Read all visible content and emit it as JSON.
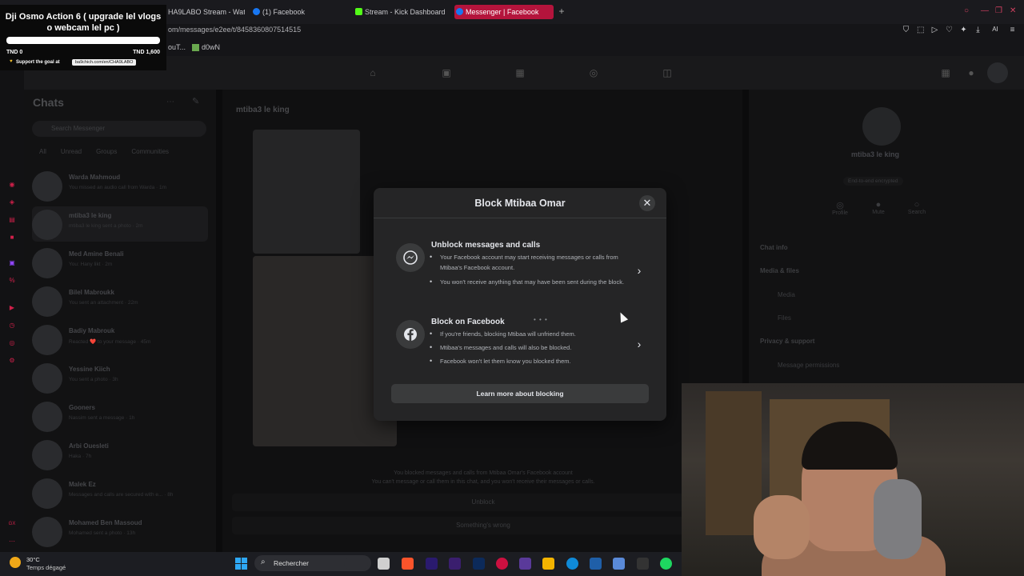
{
  "browser": {
    "tabs": [
      {
        "label": "HA9LABO Stream - Watc",
        "active": false
      },
      {
        "label": "(1) Facebook",
        "active": false
      },
      {
        "label": "Stream - Kick Dashboard",
        "active": false
      },
      {
        "label": "Messenger | Facebook",
        "active": true
      }
    ],
    "new_tab": "+",
    "url": "om/messages/e2ee/t/8458360807514515",
    "bookmarks": [
      "ouT...",
      "d0wN"
    ],
    "toolbar_icons": [
      "bookmark-icon",
      "crop-icon",
      "play-icon",
      "heart-icon",
      "extensions-icon",
      "download-icon",
      "ai-icon",
      "menu-icon"
    ],
    "ai_label": "AI"
  },
  "donation": {
    "title": "Dji Osmo Action 6 ( upgrade lel vlogs o webcam lel pc )",
    "min": "TND 0",
    "max": "TND 1,600",
    "progress": 0,
    "support_text": "Support the goal at",
    "link": "ba9chich.com/en/CHA9LABO"
  },
  "messenger": {
    "chats_title": "Chats",
    "search_placeholder": "Search Messenger",
    "filters": [
      "All",
      "Unread",
      "Groups",
      "Communities"
    ],
    "chat_list": [
      {
        "name": "Warda Mahmoud",
        "preview": "You missed an audio call from Warda · 1m"
      },
      {
        "name": "mtiba3 le king",
        "preview": "mtiba3 le king sent a photo · 2m"
      },
      {
        "name": "Med Amine Benali",
        "preview": "You: Hany likt · 2m"
      },
      {
        "name": "Bilel Mabroukk",
        "preview": "You sent an attachment · 22m"
      },
      {
        "name": "Badiy Mabrouk",
        "preview": "Reacted ❤️ to your message · 45m"
      },
      {
        "name": "Yessine Kiich",
        "preview": "You sent a photo · 3h"
      },
      {
        "name": "Gooners",
        "preview": "Nassim sent a message · 1h"
      },
      {
        "name": "Arbi Ouesleti",
        "preview": "Haka · 7h"
      },
      {
        "name": "Malek Ez",
        "preview": "Messages and calls are secured with e... · 8h"
      },
      {
        "name": "Mohamed Ben Massoud",
        "preview": "Mohamed sent a photo · 13h"
      }
    ],
    "convo_name": "mtiba3 le king",
    "blocked_line1": "You blocked messages and calls from Mtibaa Omar's Facebook account",
    "blocked_line2": "You can't message or call them in this chat, and you won't receive their messages or calls.",
    "unblock": "Unblock",
    "something_wrong": "Something's wrong",
    "info": {
      "name": "mtiba3 le king",
      "encrypted": "End-to-end encrypted",
      "actions": [
        "Profile",
        "Mute",
        "Search"
      ],
      "sections": [
        "Chat info",
        "Media & files",
        "Privacy & support"
      ],
      "items": [
        "Media",
        "Files",
        "Message permissions"
      ]
    }
  },
  "modal": {
    "title": "Block Mtibaa Omar",
    "option1": {
      "title": "Unblock messages and calls",
      "bullets": [
        "Your Facebook account may start receiving messages or calls from Mtibaa's Facebook account.",
        "You won't receive anything that may have been sent during the block."
      ]
    },
    "option2": {
      "title": "Block on Facebook",
      "bullets": [
        "If you're friends, blocking Mtibaa will unfriend them.",
        "Mtibaa's messages and calls will also be blocked.",
        "Facebook won't let them know you blocked them."
      ]
    },
    "learn_more": "Learn more about blocking",
    "loading": "• • •"
  },
  "taskbar": {
    "temp": "30°C",
    "weather": "Temps dégagé",
    "search_placeholder": "Rechercher"
  },
  "colors": {
    "accent": "#b4143c",
    "modal_bg": "#252526",
    "button_bg": "#3a3b3c"
  }
}
